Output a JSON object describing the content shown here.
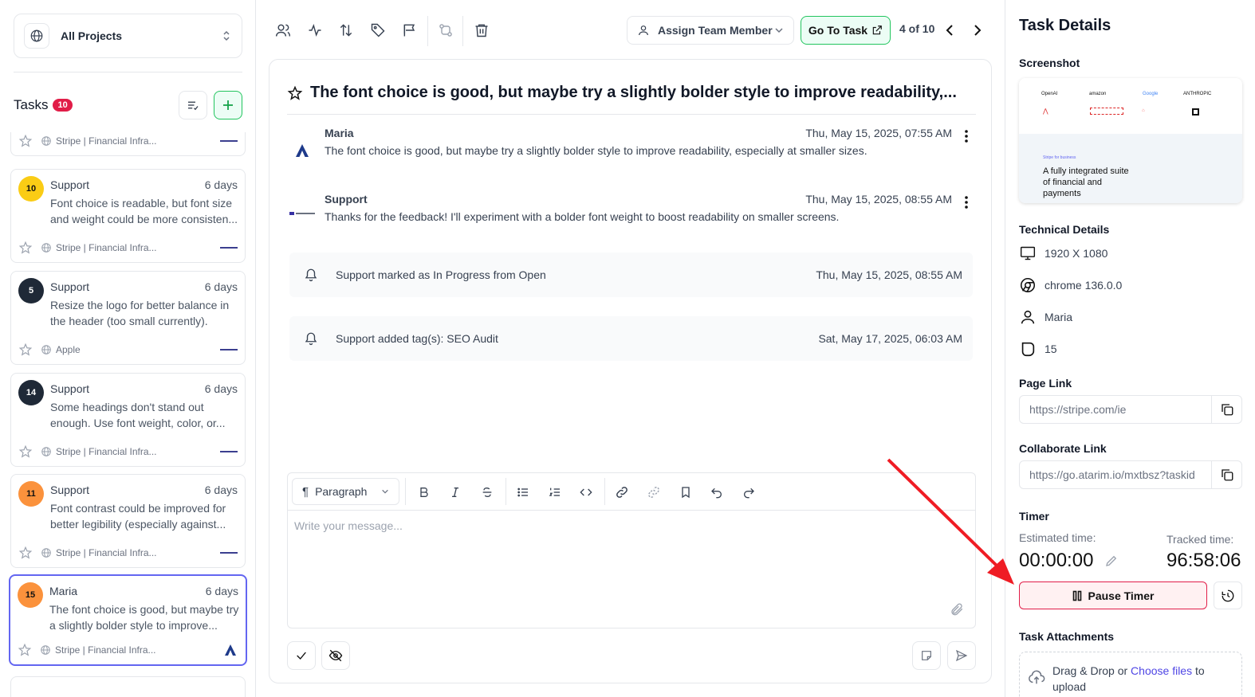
{
  "project_selector": {
    "label": "All Projects"
  },
  "tasks": {
    "title": "Tasks",
    "count": "10",
    "partial_top": {
      "site": "Stripe | Financial Infra..."
    },
    "cards": [
      {
        "badge": "10",
        "badge_color": "#facc15",
        "name": "Support",
        "days": "6 days",
        "text": "Font choice is readable, but font size and weight could be more consisten...",
        "site": "Stripe | Financial Infra...",
        "icon": "globe-icon"
      },
      {
        "badge": "5",
        "badge_color": "#1f2937",
        "name": "Support",
        "days": "6 days",
        "text": "Resize the logo for better balance in the header (too small currently).",
        "site": "Apple",
        "icon": "globe-icon"
      },
      {
        "badge": "14",
        "badge_color": "#1f2937",
        "name": "Support",
        "days": "6 days",
        "text": "Some headings don't stand out enough. Use font weight, color, or...",
        "site": "Stripe | Financial Infra...",
        "icon": "globe-icon"
      },
      {
        "badge": "11",
        "badge_color": "#fb923c",
        "name": "Support",
        "days": "6 days",
        "text": "Font contrast could be improved for better legibility (especially against...",
        "site": "Stripe | Financial Infra...",
        "icon": "globe-icon"
      },
      {
        "badge": "15",
        "badge_color": "#fb923c",
        "name": "Maria",
        "days": "6 days",
        "text": "The font choice is good, but maybe try a slightly bolder style to improve...",
        "site": "Stripe | Financial Infra...",
        "icon": "globe-icon",
        "selected": true
      }
    ]
  },
  "toolbar": {
    "assign_label": "Assign Team Member",
    "goto_label": "Go To Task",
    "pager": "4 of 10"
  },
  "thread": {
    "title": "The font choice is good, but maybe try a slightly bolder style to improve readability,...",
    "messages": [
      {
        "name": "Maria",
        "time": "Thu, May 15, 2025, 07:55 AM",
        "body": "The font choice is good, but maybe try a slightly bolder style to improve readability, especially at smaller sizes."
      },
      {
        "name": "Support",
        "time": "Thu, May 15, 2025, 08:55 AM",
        "body": "Thanks for the feedback! I'll experiment with a bolder font weight to boost readability on smaller screens."
      }
    ],
    "events": [
      {
        "text": "Support marked as In Progress from Open",
        "time": "Thu, May 15, 2025, 08:55 AM"
      },
      {
        "text": "Support added tag(s): SEO Audit",
        "time": "Sat, May 17, 2025, 06:03 AM"
      }
    ]
  },
  "editor": {
    "paragraph_label": "Paragraph",
    "placeholder": "Write your message..."
  },
  "details": {
    "title": "Task Details",
    "screenshot_label": "Screenshot",
    "screenshot_logos": [
      "OpenAI",
      "amazon",
      "Google",
      "ANTHROPIC"
    ],
    "screenshot_small": "Stripe for business",
    "screenshot_text": "A fully integrated suite of financial and payments",
    "technical_label": "Technical Details",
    "resolution": "1920 X 1080",
    "browser": "chrome 136.0.0",
    "user": "Maria",
    "task_id": "15",
    "page_link_label": "Page Link",
    "page_link": "https://stripe.com/ie",
    "collab_link_label": "Collaborate Link",
    "collab_link": "https://go.atarim.io/mxtbsz?taskid",
    "timer_label": "Timer",
    "estimated_label": "Estimated time:",
    "estimated_value": "00:00:00",
    "tracked_label": "Tracked time:",
    "tracked_value": "96:58:06",
    "pause_label": "Pause Timer",
    "attachments_label": "Task Attachments",
    "drop_text": "Drag & Drop or",
    "drop_link": "Choose files",
    "drop_suffix": "to upload"
  },
  "colors": {
    "accent_green": "#22c55e",
    "accent_red": "#e11d48",
    "accent_indigo": "#6366f1"
  }
}
